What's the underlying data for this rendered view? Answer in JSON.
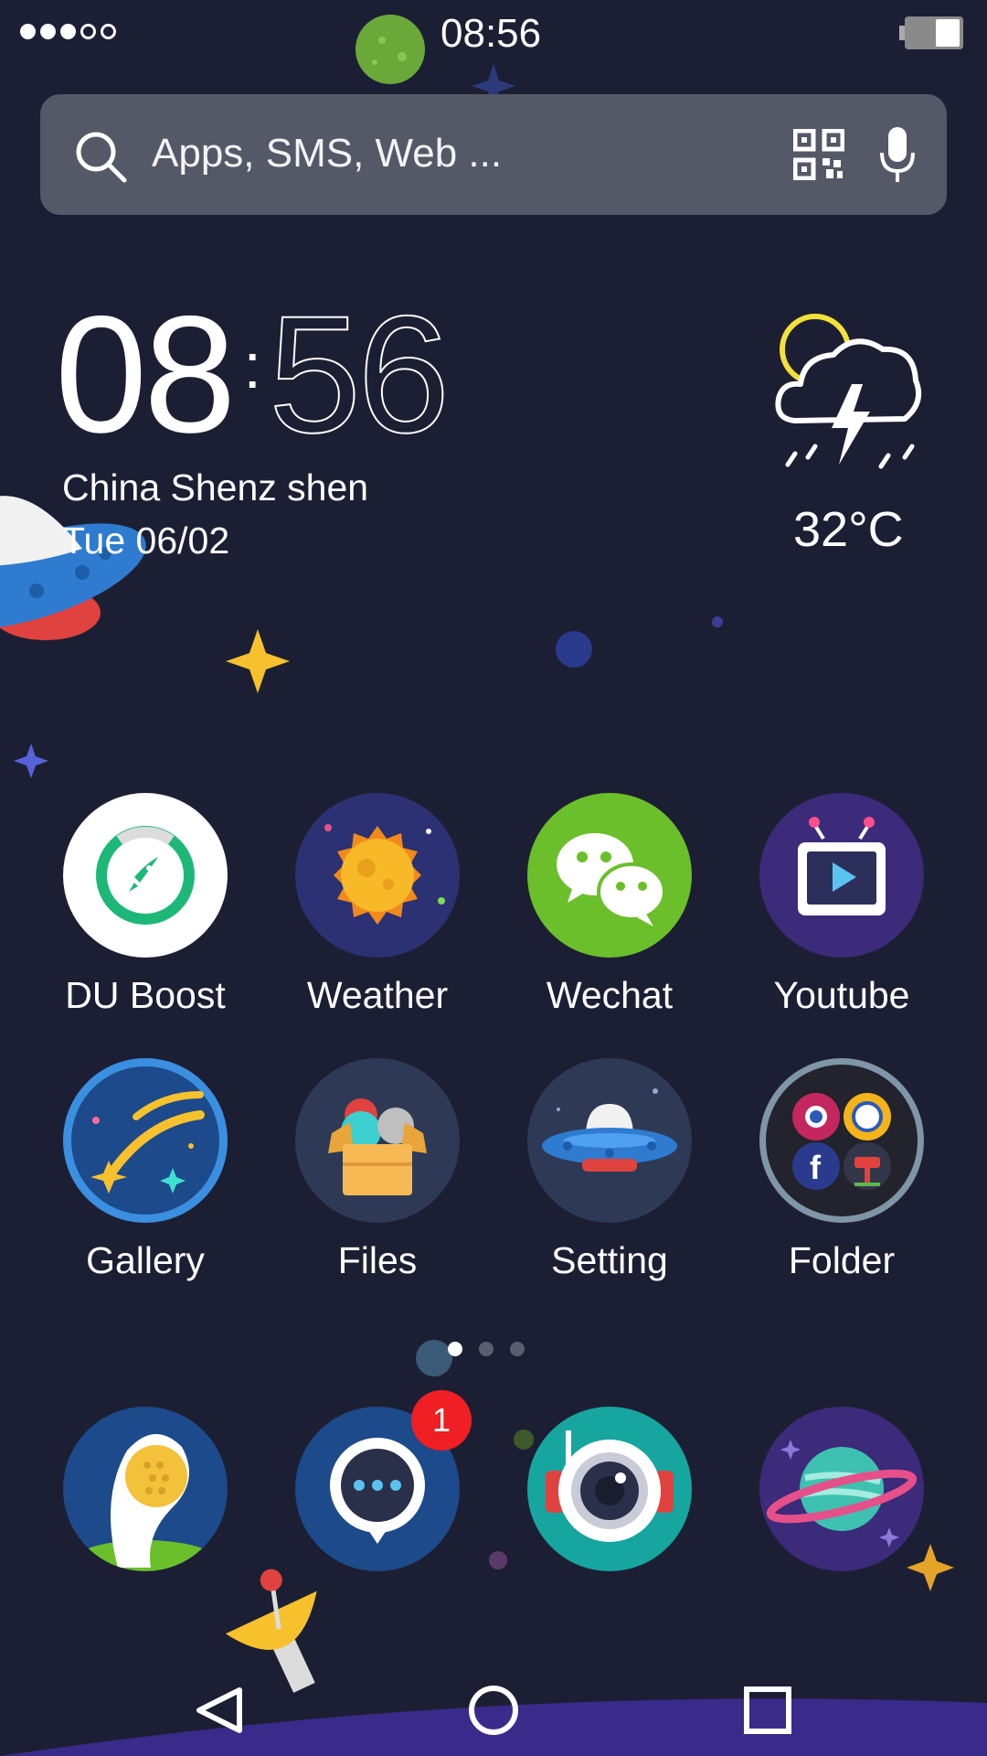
{
  "status_bar": {
    "time": "08:56"
  },
  "search": {
    "placeholder": "Apps, SMS, Web ..."
  },
  "clock_widget": {
    "hours": "08",
    "minutes": "56",
    "location": "China Shenz shen",
    "date": "Tue 06/02",
    "temperature": "32°C",
    "weather_icon": "thunderstorm-sun-icon"
  },
  "apps_row1": [
    {
      "label": "DU Boost",
      "icon": "du-boost-icon"
    },
    {
      "label": "Weather",
      "icon": "weather-sun-icon"
    },
    {
      "label": "Wechat",
      "icon": "wechat-icon"
    },
    {
      "label": "Youtube",
      "icon": "youtube-tv-icon"
    }
  ],
  "apps_row2": [
    {
      "label": "Gallery",
      "icon": "gallery-shooting-star-icon"
    },
    {
      "label": "Files",
      "icon": "files-box-icon"
    },
    {
      "label": "Setting",
      "icon": "setting-ufo-icon"
    },
    {
      "label": "Folder",
      "icon": "folder-icon"
    }
  ],
  "dock": {
    "items": [
      "phone-icon",
      "messages-icon",
      "camera-icon",
      "browser-planet-icon"
    ],
    "message_badge": "1"
  },
  "page_indicator": {
    "pages": 3,
    "active": 0
  },
  "colors": {
    "background": "#1c1f33",
    "search_bar": "#555867",
    "badge": "#ef1f24",
    "wechat": "#6bbf2b",
    "du_boost_green": "#1db878"
  }
}
